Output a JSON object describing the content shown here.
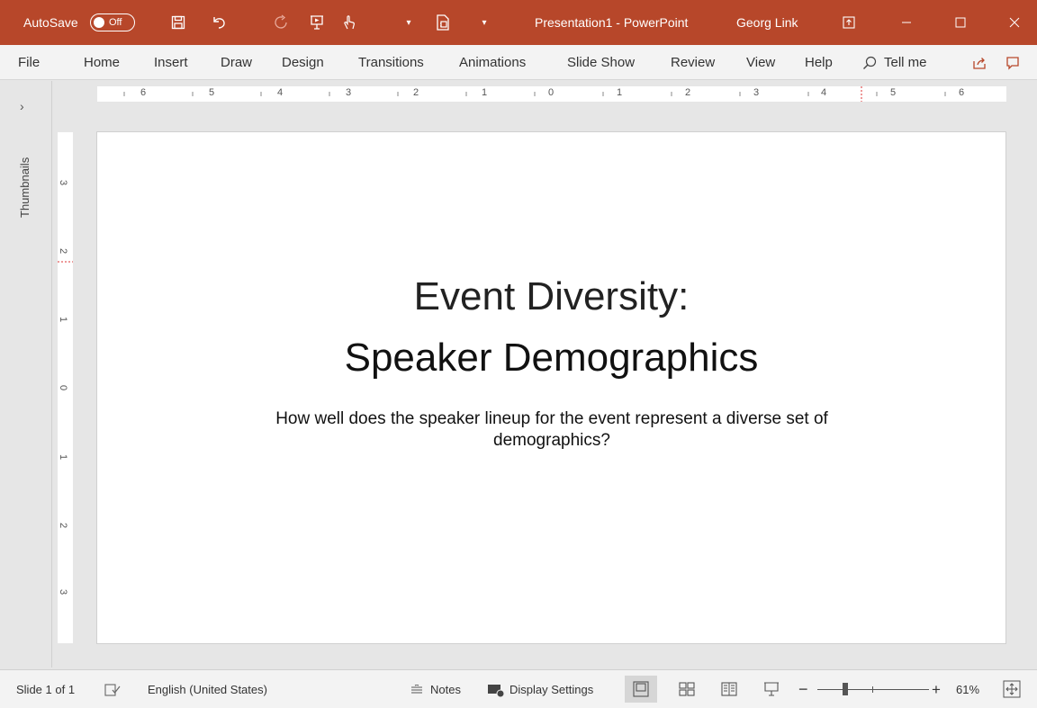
{
  "titlebar": {
    "autosave_label": "AutoSave",
    "autosave_state": "Off",
    "title": "Presentation1  -  PowerPoint",
    "user": "Georg Link"
  },
  "menu": {
    "items": [
      "File",
      "Home",
      "Insert",
      "Draw",
      "Design",
      "Transitions",
      "Animations",
      "Slide Show",
      "Review",
      "View",
      "Help"
    ],
    "tell_me": "Tell me"
  },
  "sidebar": {
    "label": "Thumbnails"
  },
  "rulers": {
    "horizontal": [
      "6",
      "5",
      "4",
      "3",
      "2",
      "1",
      "0",
      "1",
      "2",
      "3",
      "4",
      "5",
      "6"
    ],
    "vertical": [
      "3",
      "2",
      "1",
      "0",
      "1",
      "2",
      "3"
    ]
  },
  "slide": {
    "title_line1": "Event Diversity:",
    "title_line2": "Speaker Demographics",
    "subtitle": "How well does the speaker lineup for the event represent a diverse set of demographics?"
  },
  "status": {
    "slide_info": "Slide 1 of 1",
    "language": "English (United States)",
    "notes": "Notes",
    "display_settings": "Display Settings",
    "zoom_minus": "−",
    "zoom_plus": "+",
    "zoom_level": "61%"
  },
  "colors": {
    "accent": "#b7472a"
  }
}
